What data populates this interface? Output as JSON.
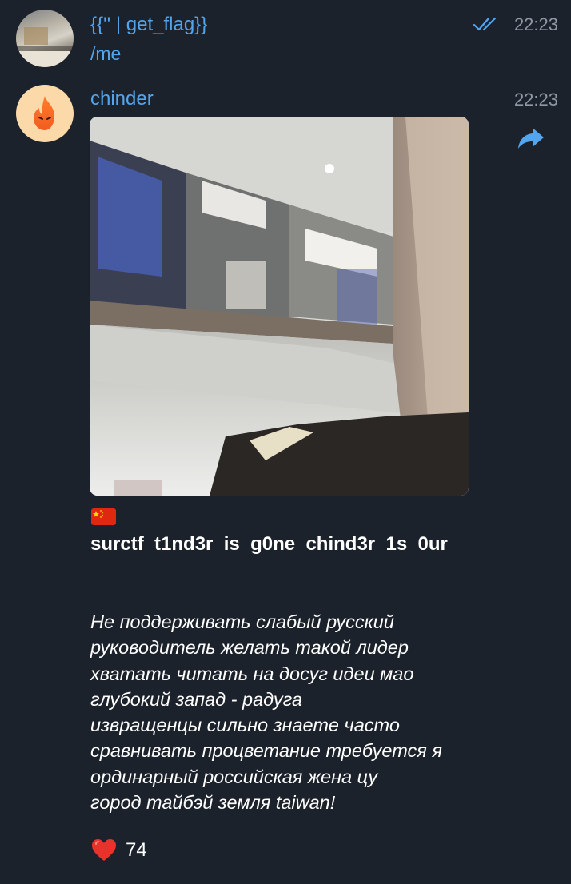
{
  "messages": [
    {
      "sender": "{{'' | get_flag}}",
      "text": "/me",
      "time": "22:23",
      "status": "read",
      "avatar": "mall-photo"
    },
    {
      "sender": "chinder",
      "time": "22:23",
      "avatar": "flame-logo",
      "media": "photo",
      "flag": "cn-flag",
      "flag_text": "surctf_t1nd3r_is_g0ne_chind3r_1s_0ur",
      "body_lines": [
        " Не поддерживать слабый русский",
        "руководитель желать такой лидер",
        "хватать читать на досуг идеи мао",
        "глубокий запад - радуга",
        "извращенцы сильно знаете часто",
        "сравнивать процветание требуется я",
        "ординарный российская жена цу",
        "город тайбэй земля taiwan!"
      ],
      "reaction": {
        "icon": "heart-icon",
        "count": "74"
      }
    }
  ],
  "colors": {
    "background": "#1c222b",
    "accent": "#53a5ee",
    "muted": "#8e99a6",
    "text": "#ffffff"
  }
}
